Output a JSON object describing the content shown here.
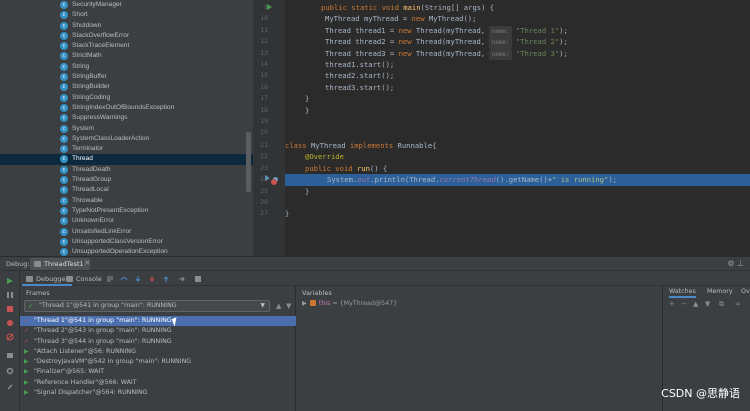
{
  "project_tree": {
    "items": [
      {
        "label": "SecurityManager",
        "selected": false
      },
      {
        "label": "Short",
        "selected": false
      },
      {
        "label": "Shutdown",
        "selected": false
      },
      {
        "label": "StackOverflowError",
        "selected": false
      },
      {
        "label": "StackTraceElement",
        "selected": false
      },
      {
        "label": "StrictMath",
        "selected": false
      },
      {
        "label": "String",
        "selected": false
      },
      {
        "label": "StringBuffer",
        "selected": false
      },
      {
        "label": "StringBuilder",
        "selected": false
      },
      {
        "label": "StringCoding",
        "selected": false
      },
      {
        "label": "StringIndexOutOfBoundsException",
        "selected": false
      },
      {
        "label": "SuppressWarnings",
        "selected": false
      },
      {
        "label": "System",
        "selected": false
      },
      {
        "label": "SystemClassLoaderAction",
        "selected": false
      },
      {
        "label": "Terminator",
        "selected": false
      },
      {
        "label": "Thread",
        "selected": true
      },
      {
        "label": "ThreadDeath",
        "selected": false
      },
      {
        "label": "ThreadGroup",
        "selected": false
      },
      {
        "label": "ThreadLocal",
        "selected": false
      },
      {
        "label": "Throwable",
        "selected": false
      },
      {
        "label": "TypeNotPresentException",
        "selected": false
      },
      {
        "label": "UnknownError",
        "selected": false
      },
      {
        "label": "UnsatisfiedLinkError",
        "selected": false
      },
      {
        "label": "UnsupportedClassVersionError",
        "selected": false
      },
      {
        "label": "UnsupportedOperationException",
        "selected": false
      }
    ]
  },
  "editor": {
    "line_numbers": [
      "9",
      "10",
      "11",
      "12",
      "13",
      "14",
      "15",
      "16",
      "17",
      "18",
      "19",
      "20",
      "21",
      "22",
      "23",
      "24",
      "25",
      "26",
      "27"
    ],
    "code": {
      "l9_kw": "public static void ",
      "l9_m": "main",
      "l9_rest": "(String[] args) {",
      "l10_a": "MyThread myThread = ",
      "l10_kw": "new ",
      "l10_b": "MyThread();",
      "l11_a": "Thread thread1 = ",
      "l11_kw": "new ",
      "l11_b": "Thread(myThread, ",
      "l11_hint": "name:",
      "l11_str": "\"Thread 1\"",
      "l11_end": ");",
      "l12_a": "Thread thread2 = ",
      "l12_kw": "new ",
      "l12_b": "Thread(myThread, ",
      "l12_hint": "name:",
      "l12_str": "\"Thread 2\"",
      "l12_end": ");",
      "l13_a": "Thread thread3 = ",
      "l13_kw": "new ",
      "l13_b": "Thread(myThread, ",
      "l13_hint": "name:",
      "l13_str": "\"Thread 3\"",
      "l13_end": ");",
      "l14": "thread1.start();",
      "l15": "thread2.start();",
      "l16": "thread3.start();",
      "l17": "}",
      "l18": "}",
      "l21_kw1": "class ",
      "l21_a": "MyThread ",
      "l21_kw2": "implements ",
      "l21_b": "Runnable{",
      "l22_ann": "@Override",
      "l23_kw": "public void ",
      "l23_m": "run",
      "l23_rest": "() {",
      "l24_a": "System.",
      "l24_fld": "out",
      "l24_b": ".println(Thread.",
      "l24_c": "currentThread",
      "l24_d": "().getName()+",
      "l24_str": "\" is running\"",
      "l24_end": ");",
      "l25": "}",
      "l27": "}"
    }
  },
  "debug": {
    "title_label": "Debug:",
    "config_tab": "ThreadTest1",
    "tabs": {
      "debugger": "Debugger",
      "console": "Console"
    },
    "frames": {
      "header": "Frames",
      "selected_thread": "\"Thread 1\"@541 in group \"main\": RUNNING",
      "threads": [
        {
          "label": "\"Thread 1\"@541 in group \"main\": RUNNING",
          "state": "suspended",
          "selected": true
        },
        {
          "label": "\"Thread 2\"@543 in group \"main\": RUNNING",
          "state": "suspended",
          "selected": false
        },
        {
          "label": "\"Thread 3\"@544 in group \"main\": RUNNING",
          "state": "suspended",
          "selected": false
        },
        {
          "label": "\"Attach Listener\"@56: RUNNING",
          "state": "running",
          "selected": false
        },
        {
          "label": "\"DestroyJavaVM\"@542 in group \"main\": RUNNING",
          "state": "running",
          "selected": false
        },
        {
          "label": "\"Finalizer\"@565: WAIT",
          "state": "running",
          "selected": false
        },
        {
          "label": "\"Reference Handler\"@566: WAIT",
          "state": "running",
          "selected": false
        },
        {
          "label": "\"Signal Dispatcher\"@564: RUNNING",
          "state": "running",
          "selected": false
        }
      ]
    },
    "variables": {
      "header": "Variables",
      "name": "this",
      "value": "= {MyThread@547}"
    },
    "watches": {
      "tab1": "Watches",
      "tab2": "Memory",
      "tab3": "Ov"
    }
  },
  "watermark": "CSDN @思静语"
}
